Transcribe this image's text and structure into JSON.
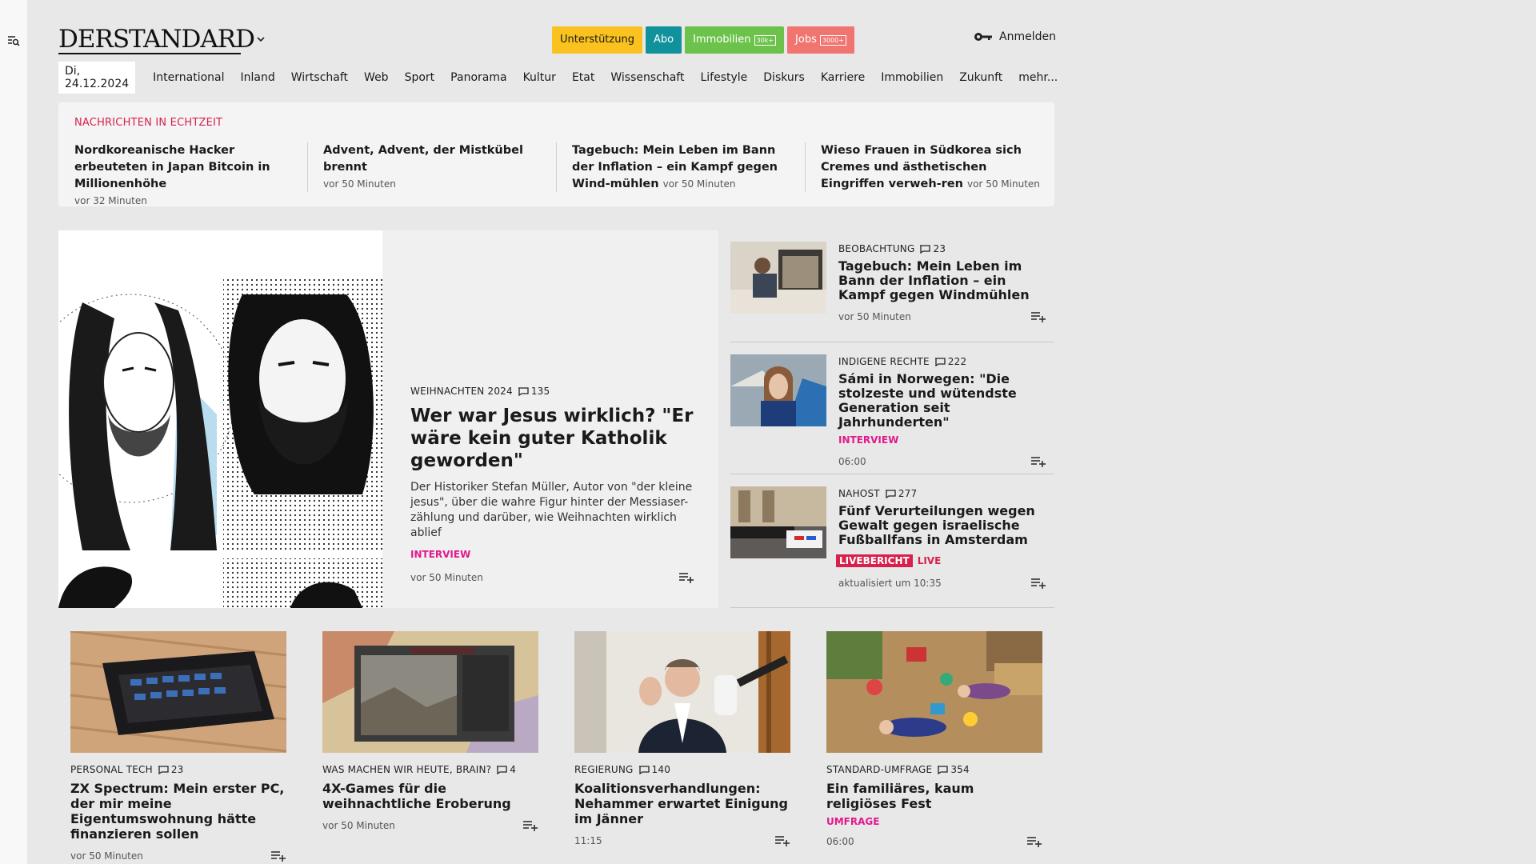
{
  "header": {
    "logo": "DERSTANDARD",
    "buttons": [
      {
        "label": "Unterstützung",
        "bg": "#f9c21e",
        "fg": "#1a1a1a",
        "badge": ""
      },
      {
        "label": "Abo",
        "bg": "#10929c",
        "fg": "#ffffff",
        "badge": ""
      },
      {
        "label": "Immobilien",
        "bg": "#6cc24a",
        "fg": "#ffffff",
        "badge": "30k+"
      },
      {
        "label": "Jobs",
        "bg": "#f0746f",
        "fg": "#ffffff",
        "badge": "3000+"
      }
    ],
    "login_label": "Anmelden"
  },
  "nav": {
    "date": "Di, 24.12.2024",
    "items": [
      "International",
      "Inland",
      "Wirtschaft",
      "Web",
      "Sport",
      "Panorama",
      "Kultur",
      "Etat",
      "Wissenschaft",
      "Lifestyle",
      "Diskurs",
      "Karriere",
      "Immobilien",
      "Zukunft",
      "mehr..."
    ]
  },
  "ticker": {
    "title": "NACHRICHTEN IN ECHTZEIT",
    "items": [
      {
        "headline": "Nordkoreanische Hacker erbeuteten in Japan Bitcoin in Millionenhöhe",
        "time": "vor 32 Minuten"
      },
      {
        "headline": "Advent, Advent, der Mistkübel brennt",
        "time": "vor 50 Minuten"
      },
      {
        "headline": "Tagebuch: Mein Leben im Bann der Inflation – ein Kampf gegen Wind-mühlen",
        "time": "vor 50 Minuten"
      },
      {
        "headline": "Wieso Frauen in Südkorea sich Cremes und ästhetischen Eingriffen verweh-ren",
        "time": "vor 50 Minuten"
      }
    ]
  },
  "hero": {
    "kicker": "WEIHNACHTEN 2024",
    "comments": "135",
    "title": "Wer war Jesus wirklich? \"Er wäre kein guter Katholik geworden\"",
    "teaser": "Der Historiker Stefan Müller, Autor von \"der kleine jesus\", über die wahre Figur hinter der Messiaser-zählung und darüber, wie Weihnachten wirklich ablief",
    "label": "INTERVIEW",
    "time": "vor 50 Minuten"
  },
  "side_articles": [
    {
      "kicker": "BEOBACHTUNG",
      "comments": "23",
      "title": "Tagebuch: Mein Leben im Bann der Inflation – ein Kampf gegen Windmühlen",
      "label": "",
      "time": "vor 50 Minuten"
    },
    {
      "kicker": "INDIGENE RECHTE",
      "comments": "222",
      "title": "Sámi in Norwegen: \"Die stolzeste und wütendste Generation seit Jahrhunderten\"",
      "label": "INTERVIEW",
      "time": "06:00"
    },
    {
      "kicker": "NAHOST",
      "comments": "277",
      "title": "Fünf Verurteilungen wegen Gewalt gegen israelische Fußballfans in Amsterdam",
      "badge": "LIVEBERICHT",
      "live": "LIVE",
      "time": "aktualisiert um 10:35"
    }
  ],
  "cards": [
    {
      "kicker": "PERSONAL TECH",
      "comments": "23",
      "title": "ZX Spectrum: Mein erster PC, der mir meine Eigentumswohnung hätte finanzieren sollen",
      "label": "",
      "time": "vor 50 Minuten"
    },
    {
      "kicker": "WAS MACHEN WIR HEUTE, BRAIN?",
      "comments": "4",
      "title": "4X-Games für die weihnachtliche Eroberung",
      "label": "",
      "time": "vor 50 Minuten"
    },
    {
      "kicker": "REGIERUNG",
      "comments": "140",
      "title": "Koalitionsverhandlungen: Nehammer erwartet Einigung im Jänner",
      "label": "",
      "time": "11:15"
    },
    {
      "kicker": "STANDARD-UMFRAGE",
      "comments": "354",
      "title": "Ein familiäres, kaum religiöses Fest",
      "label": "UMFRAGE",
      "time": "06:00"
    }
  ],
  "colors": {
    "accent_red": "#d8204c",
    "accent_pink": "#e2198d"
  }
}
